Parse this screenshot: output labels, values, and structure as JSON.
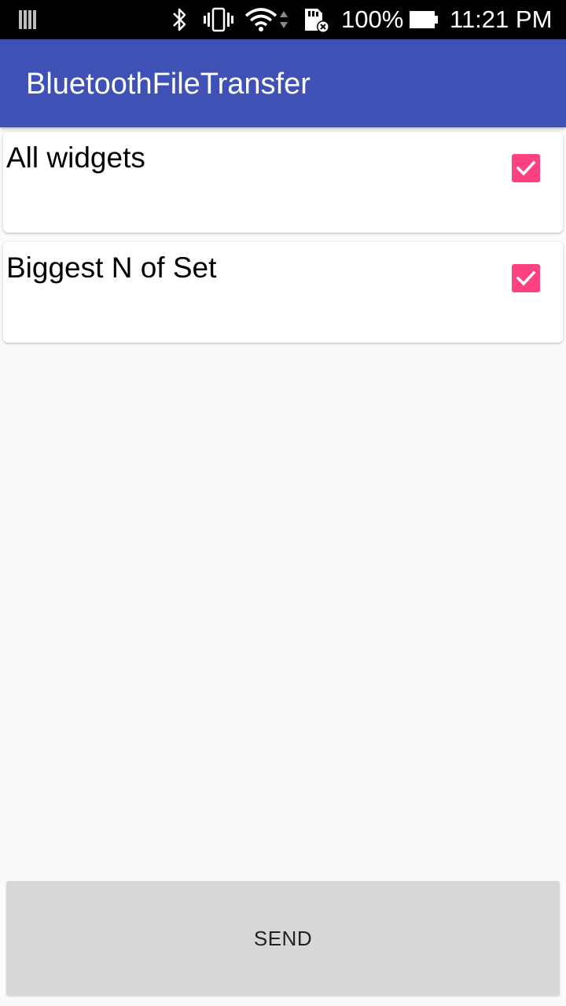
{
  "status_bar": {
    "icons": [
      "signal-bars-icon",
      "bluetooth-icon",
      "vibrate-icon",
      "wifi-icon",
      "data-arrows-icon",
      "sd-card-icon",
      "battery-icon"
    ],
    "battery": "100%",
    "time": "11:21 PM"
  },
  "app_bar": {
    "title": "BluetoothFileTransfer"
  },
  "colors": {
    "primary": "#3f51b5",
    "accent": "#ff4081",
    "button": "#d6d7d7",
    "background": "#fafafa"
  },
  "items": [
    {
      "label": "All widgets",
      "checked": true
    },
    {
      "label": "Biggest N of Set",
      "checked": true
    }
  ],
  "send_button": {
    "label": "SEND"
  }
}
